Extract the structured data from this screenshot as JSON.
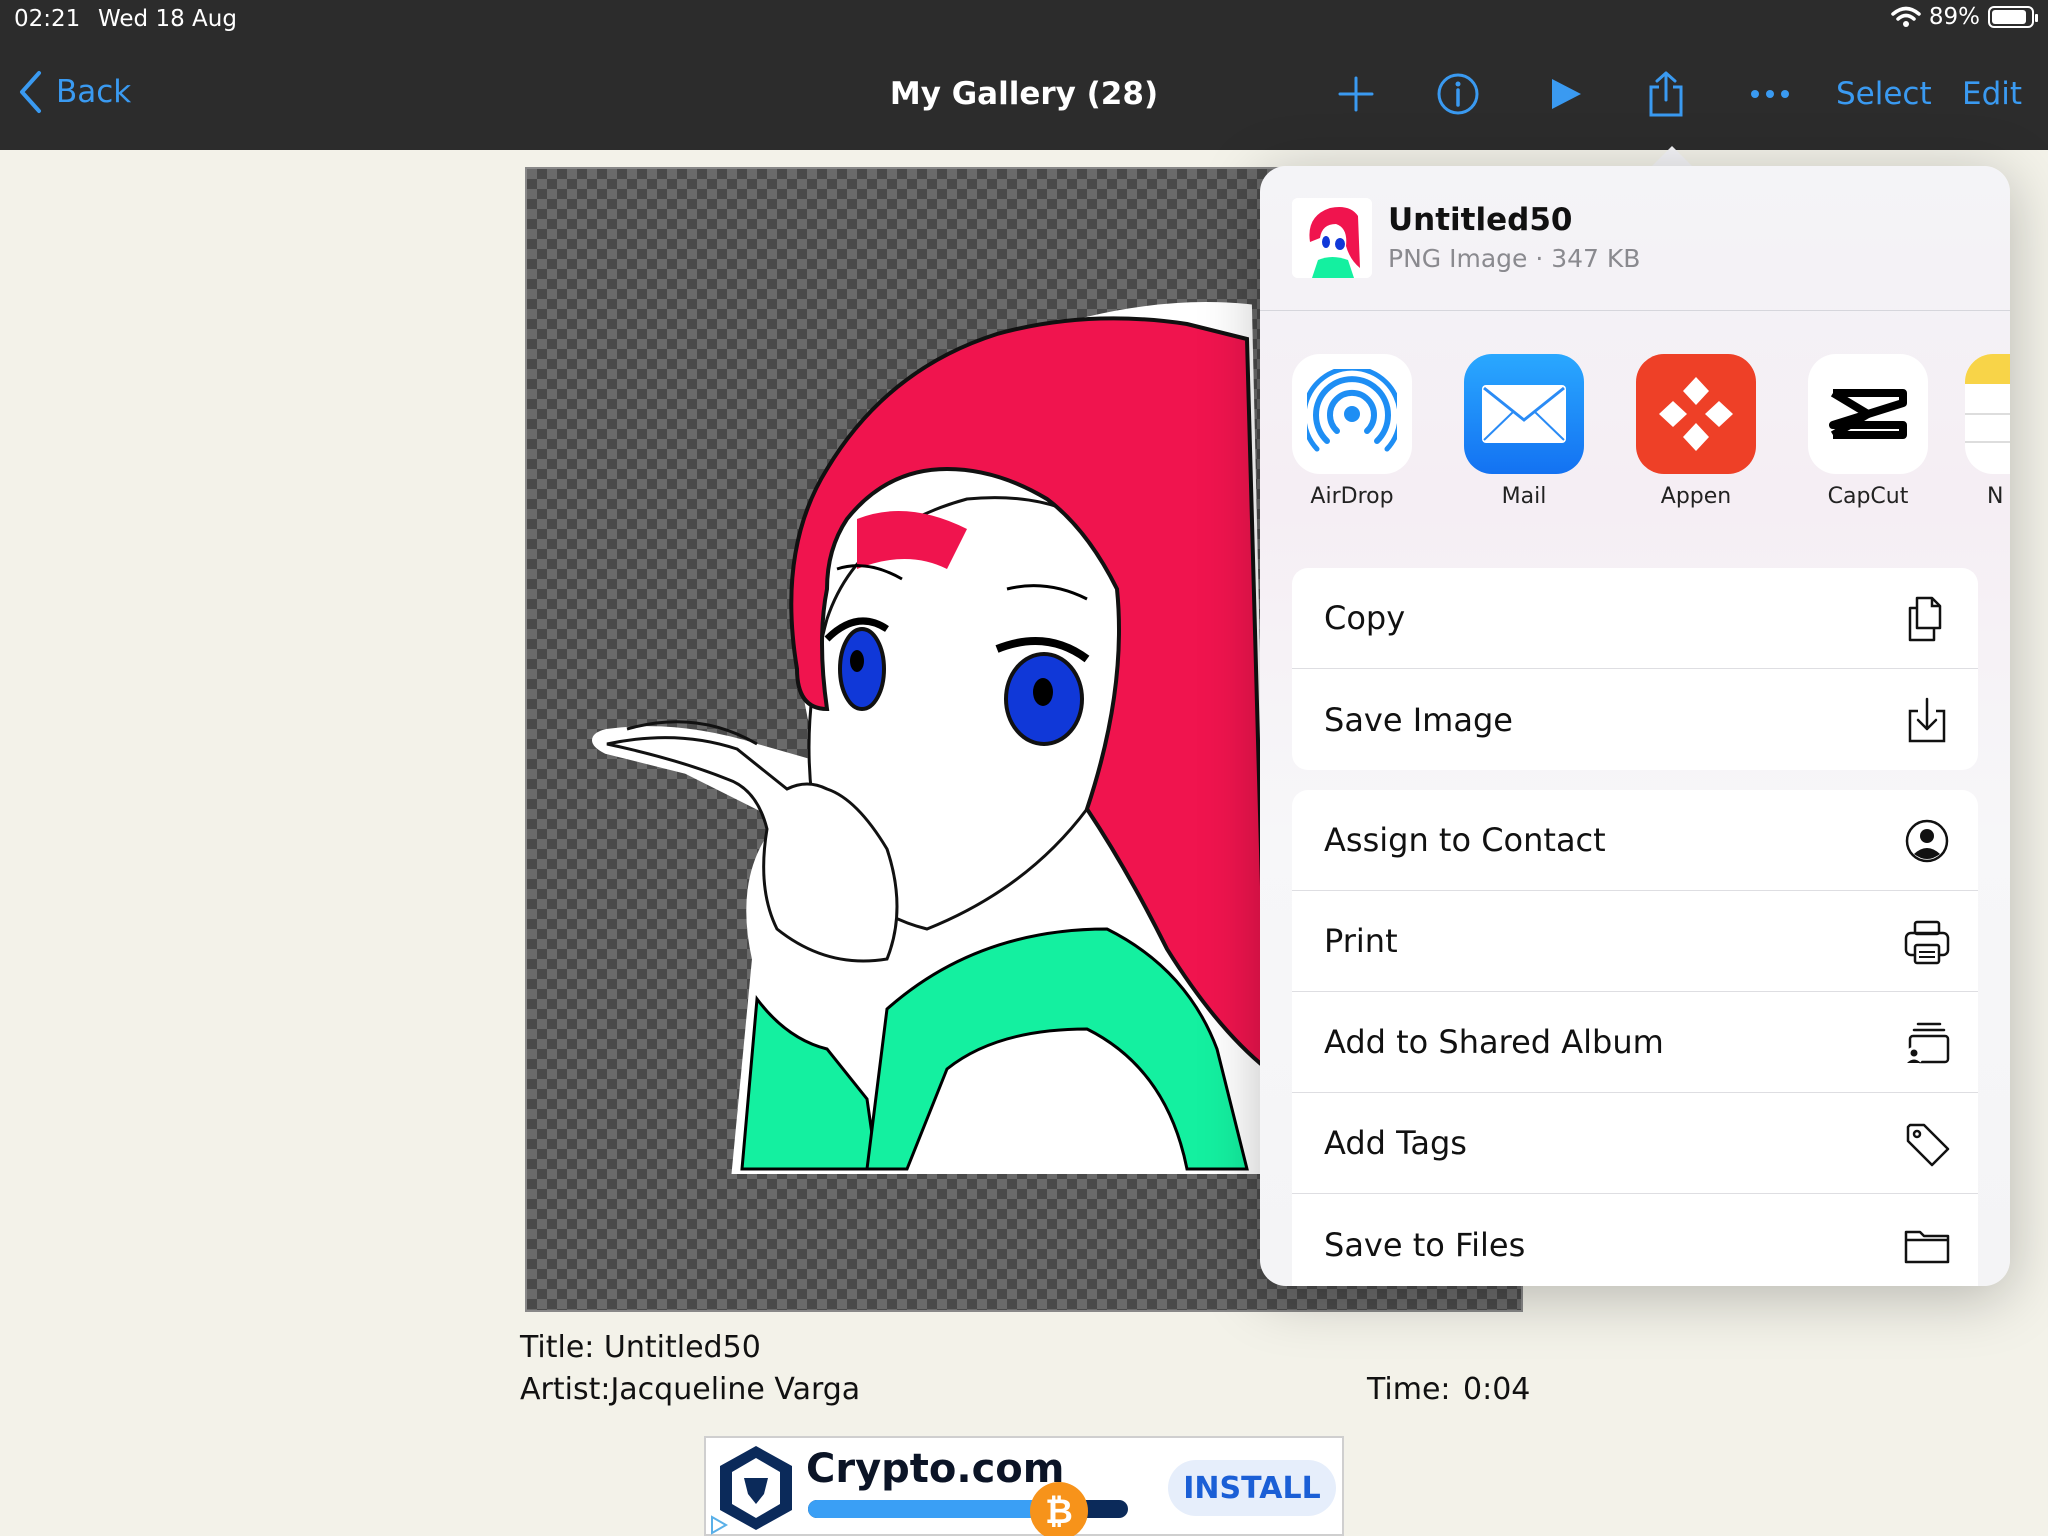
{
  "status": {
    "time": "02:21",
    "date": "Wed 18 Aug",
    "battery": "89%",
    "battery_level": 0.89
  },
  "nav": {
    "back_label": "Back",
    "title": "My Gallery (28)",
    "select_label": "Select",
    "edit_label": "Edit",
    "icons": [
      "plus-icon",
      "info-icon",
      "play-icon",
      "share-icon",
      "more-icon"
    ]
  },
  "artwork": {
    "title_line": "Title: Untitled50",
    "artist_line": "Artist:Jacqueline Varga",
    "time_label": "Time:",
    "time_value": "0:04"
  },
  "share_sheet": {
    "file_name": "Untitled50",
    "file_info": "PNG Image · 347 KB",
    "apps": [
      {
        "label": "AirDrop",
        "icon": "airdrop-icon"
      },
      {
        "label": "Mail",
        "icon": "mail-icon"
      },
      {
        "label": "Appen",
        "icon": "appen-icon"
      },
      {
        "label": "CapCut",
        "icon": "capcut-icon"
      },
      {
        "label": "N",
        "icon": "notes-icon"
      }
    ],
    "group1": [
      "Copy",
      "Save Image"
    ],
    "group2": [
      "Assign to Contact",
      "Print",
      "Add to Shared Album",
      "Add Tags",
      "Save to Files"
    ]
  },
  "ad": {
    "brand": "Crypto.com",
    "install_label": "INSTALL",
    "progress": 0.75
  },
  "colors": {
    "accent": "#3a9af1",
    "navbar": "#2c2c2c",
    "hair": "#f0144e",
    "collar": "#14f0a0",
    "eye": "#1038d8"
  }
}
